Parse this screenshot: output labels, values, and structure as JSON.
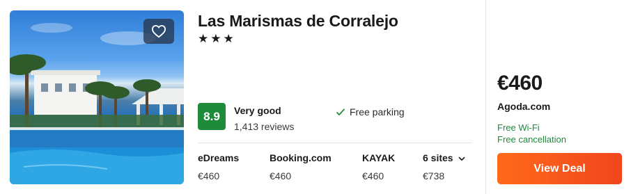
{
  "hotel": {
    "name": "Las Marismas de Corralejo",
    "stars": "★★★",
    "star_rating": 3
  },
  "rating": {
    "score": "8.9",
    "label": "Very good",
    "reviews": "1,413 reviews",
    "badge_color": "#1e8b3a"
  },
  "amenity": {
    "label": "Free parking",
    "icon": "check-icon"
  },
  "sites": [
    {
      "name": "eDreams",
      "price": "€460"
    },
    {
      "name": "Booking.com",
      "price": "€460"
    },
    {
      "name": "KAYAK",
      "price": "€460"
    },
    {
      "name": "6 sites",
      "price": "€738",
      "icon": "chevron-down-icon"
    }
  ],
  "deal": {
    "price": "€460",
    "provider": "Agoda.com",
    "perks": [
      "Free Wi-Fi",
      "Free cancellation"
    ],
    "button_label": "View Deal",
    "button_color": "#f25a1c",
    "perk_color": "#1e8b3a"
  },
  "photo": {
    "icon": "heart-icon",
    "alt": "hotel-pool-photo"
  }
}
